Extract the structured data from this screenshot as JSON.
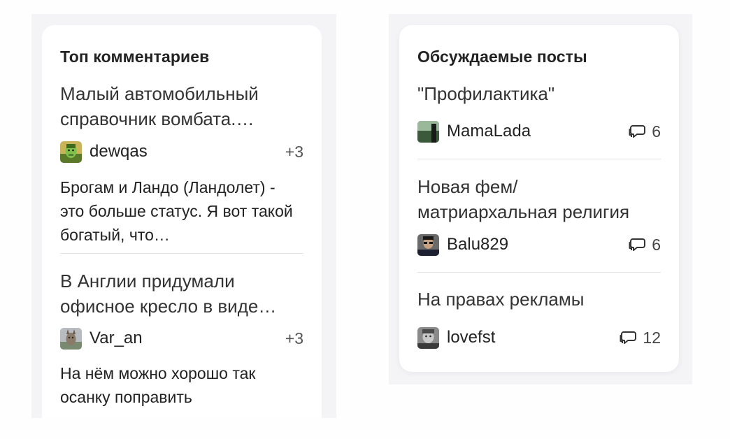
{
  "top_comments": {
    "title": "Топ комментариев",
    "items": [
      {
        "post_title": "Малый автомобильный справочник вомбата.…",
        "author": "dewqas",
        "score": "+3",
        "comment": "Брогам и Ландо (Ландолет) - это больше статус. Я вот такой богатый, что…"
      },
      {
        "post_title": "В Англии придумали офисное кресло в виде…",
        "author": "Var_an",
        "score": "+3",
        "comment": "На нём можно хорошо так осанку поправить"
      }
    ]
  },
  "discussed_posts": {
    "title": "Обсуждаемые посты",
    "items": [
      {
        "post_title": "\"Профилактика\"",
        "author": "MamaLada",
        "comments": "6"
      },
      {
        "post_title": "Новая фем/ матриархальная религия",
        "author": "Balu829",
        "comments": "6"
      },
      {
        "post_title": "На правах рекламы",
        "author": "lovefst",
        "comments": "12"
      }
    ]
  },
  "icons": {
    "comments": "speech-bubbles-icon"
  },
  "colors": {
    "card_bg": "#ffffff",
    "page_bg": "#f4f4f6",
    "text": "#222222",
    "divider": "#e2e2e4"
  }
}
